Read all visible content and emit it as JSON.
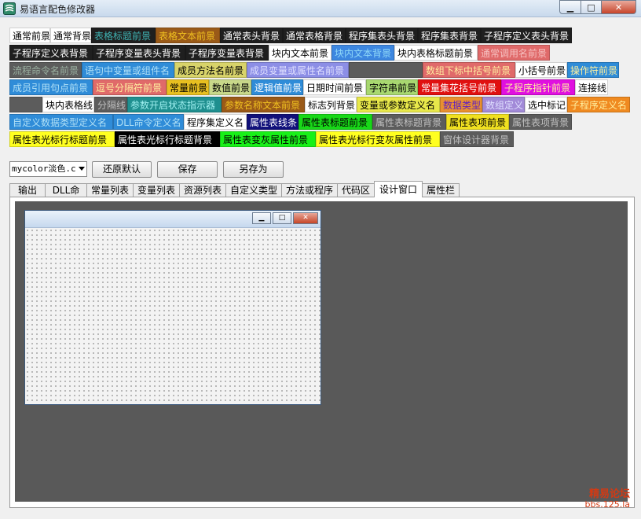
{
  "window": {
    "title": "易语言配色修改器",
    "min_glyph": "▁",
    "max_glyph": "□",
    "close_glyph": "✕"
  },
  "color_rows": [
    [
      {
        "label": "通常前景",
        "bg": "#ffffff",
        "fg": "#000000",
        "w": 52
      },
      {
        "label": "通常背景",
        "bg": "#ffffff",
        "fg": "#000000",
        "w": 52
      },
      {
        "label": "表格标题前景",
        "bg": "#1f1f1f",
        "fg": "#3fb3b3",
        "w": 82
      },
      {
        "label": "表格文本前景",
        "bg": "#9a5a18",
        "fg": "#f0c020",
        "w": 82
      },
      {
        "label": "通常表头背景",
        "bg": "#1f1f1f",
        "fg": "#ffffff",
        "w": 80
      },
      {
        "label": "通常表格背景",
        "bg": "#1f1f1f",
        "fg": "#ffffff",
        "w": 80
      },
      {
        "label": "程序集表头背景",
        "bg": "#1f1f1f",
        "fg": "#ffffff",
        "w": 92
      },
      {
        "label": "程序集表背景",
        "bg": "#1f1f1f",
        "fg": "#ffffff",
        "w": 80
      },
      {
        "label": "子程序定义表头背景",
        "bg": "#1f1f1f",
        "fg": "#ffffff",
        "w": 116
      }
    ],
    [
      {
        "label": "子程序定义表背景",
        "bg": "#1f1f1f",
        "fg": "#ffffff",
        "w": 106
      },
      {
        "label": "子程序变量表头背景",
        "bg": "#1f1f1f",
        "fg": "#ffffff",
        "w": 118
      },
      {
        "label": "子程序变量表背景",
        "bg": "#1f1f1f",
        "fg": "#ffffff",
        "w": 106
      },
      {
        "label": "块内文本前景",
        "bg": "#ffffff",
        "fg": "#000000",
        "w": 80
      },
      {
        "label": "块内文本背景",
        "bg": "#3d87e0",
        "fg": "#8fd8f8",
        "w": 80
      },
      {
        "label": "块内表格标题前景",
        "bg": "#ffffff",
        "fg": "#000000",
        "w": 106
      },
      {
        "label": "通常调用名前景",
        "bg": "#e06a6a",
        "fg": "#f6c0c0",
        "w": 92
      }
    ],
    [
      {
        "label": "流程命令名前景",
        "bg": "#5c5c5c",
        "fg": "#9ab0a0",
        "w": 92
      },
      {
        "label": "语句中变量或组件名",
        "bg": "#2f8cd8",
        "fg": "#b0e0f6",
        "w": 118
      },
      {
        "label": "成员方法名前景",
        "bg": "#d8d36a",
        "fg": "#000000",
        "w": 92
      },
      {
        "label": "成员变量或属性名前景",
        "bg": "#8c8ee6",
        "fg": "#e0e0ff",
        "w": 130
      },
      {
        "label": "",
        "bg": "#5c5c5c",
        "fg": "#ffffff",
        "w": 94
      },
      {
        "label": "数组下标中括号前景",
        "bg": "#e06a6a",
        "fg": "#fff0a0",
        "w": 118
      },
      {
        "label": "小括号前景",
        "bg": "#ffffff",
        "fg": "#000000",
        "w": 66
      },
      {
        "label": "操作符前景",
        "bg": "#2f8cd8",
        "fg": "#fff0a0",
        "w": 66
      }
    ],
    [
      {
        "label": "成员引用句点前景",
        "bg": "#2f8cd8",
        "fg": "#b0e0f6",
        "w": 106
      },
      {
        "label": "逗号分隔符前景",
        "bg": "#e06a6a",
        "fg": "#fff0a0",
        "w": 94
      },
      {
        "label": "常量前景",
        "bg": "#e8c020",
        "fg": "#000000",
        "w": 54
      },
      {
        "label": "数值前景",
        "bg": "#c8d88a",
        "fg": "#000000",
        "w": 54
      },
      {
        "label": "逻辑值前景",
        "bg": "#2f8cd8",
        "fg": "#ffffff",
        "w": 66
      },
      {
        "label": "日期时间前景",
        "bg": "#ffffff",
        "fg": "#000000",
        "w": 80
      },
      {
        "label": "字符串前景",
        "bg": "#a8d870",
        "fg": "#000000",
        "w": 66
      },
      {
        "label": "常量集花括号前景",
        "bg": "#e01010",
        "fg": "#ffffff",
        "w": 106
      },
      {
        "label": "子程序指针前景",
        "bg": "#e010e0",
        "fg": "#fff0a0",
        "w": 94
      },
      {
        "label": "连接线",
        "bg": "#ffffff",
        "fg": "#000000",
        "w": 42
      }
    ],
    [
      {
        "label": "",
        "bg": "#5c5c5c",
        "fg": "#ffffff",
        "w": 42
      },
      {
        "label": "块内表格线",
        "bg": "#ffffff",
        "fg": "#000000",
        "w": 66
      },
      {
        "label": "分隔线",
        "bg": "#5c5c5c",
        "fg": "#c0c0c0",
        "w": 42
      },
      {
        "label": "参数开启状态指示器",
        "bg": "#1f8f8f",
        "fg": "#a0f0f0",
        "w": 120
      },
      {
        "label": "参数名称文本前景",
        "bg": "#9a5a18",
        "fg": "#f0c020",
        "w": 106
      },
      {
        "label": "标志列背景",
        "bg": "#ffffff",
        "fg": "#000000",
        "w": 66
      },
      {
        "label": "变量或参数定义名",
        "bg": "#e8e84a",
        "fg": "#000000",
        "w": 106
      },
      {
        "label": "数据类型",
        "bg": "#e89030",
        "fg": "#6020c0",
        "w": 54
      },
      {
        "label": "数组定义",
        "bg": "#a28ad8",
        "fg": "#e0e0ff",
        "w": 54
      },
      {
        "label": "选中标记",
        "bg": "#ffffff",
        "fg": "#000000",
        "w": 54
      },
      {
        "label": "子程序定义名",
        "bg": "#f08a20",
        "fg": "#fff0a0",
        "w": 80
      }
    ],
    [
      {
        "label": "自定义数据类型定义名",
        "bg": "#2f8cd8",
        "fg": "#b0e0f6",
        "w": 132
      },
      {
        "label": "DLL命令定义名",
        "bg": "#2f8cd8",
        "fg": "#b0e0f6",
        "w": 90
      },
      {
        "label": "程序集定义名",
        "bg": "#ffffff",
        "fg": "#000000",
        "w": 80
      },
      {
        "label": "属性表线条",
        "bg": "#10107a",
        "fg": "#ffffff",
        "w": 66
      },
      {
        "label": "属性表标题前景",
        "bg": "#18d818",
        "fg": "#000000",
        "w": 94
      },
      {
        "label": "属性表标题背景",
        "bg": "#5c5c5c",
        "fg": "#c0c0c0",
        "w": 94
      },
      {
        "label": "属性表项前景",
        "bg": "#f0e020",
        "fg": "#000000",
        "w": 80
      },
      {
        "label": "属性表项背景",
        "bg": "#5c5c5c",
        "fg": "#c0c0c0",
        "w": 80
      }
    ],
    [
      {
        "label": "属性表光标行标题前景",
        "bg": "#ffff20",
        "fg": "#000000",
        "w": 134
      },
      {
        "label": "属性表光标行标题背景",
        "bg": "#000000",
        "fg": "#ffffff",
        "w": 134
      },
      {
        "label": "属性表变灰属性前景",
        "bg": "#18f018",
        "fg": "#000000",
        "w": 122
      },
      {
        "label": "属性表光标行变灰属性前景",
        "bg": "#ffff20",
        "fg": "#000000",
        "w": 158
      },
      {
        "label": "窗体设计器背景",
        "bg": "#5c5c5c",
        "fg": "#c0c0c0",
        "w": 94
      }
    ]
  ],
  "toolbar": {
    "scheme_value": "mycolor淡色.c",
    "restore_label": "还原默认",
    "save_label": "保存",
    "saveas_label": "另存为"
  },
  "tabs": [
    {
      "label": "输出",
      "active": false,
      "w": 46
    },
    {
      "label": "DLL命令",
      "active": false,
      "w": 54
    },
    {
      "label": "常量列表",
      "active": false,
      "w": 60
    },
    {
      "label": "变量列表",
      "active": false,
      "w": 60
    },
    {
      "label": "资源列表",
      "active": false,
      "w": 60
    },
    {
      "label": "自定义类型",
      "active": false,
      "w": 72
    },
    {
      "label": "方法或程序",
      "active": false,
      "w": 72
    },
    {
      "label": "代码区",
      "active": false,
      "w": 48
    },
    {
      "label": "设计窗口",
      "active": true,
      "w": 62
    },
    {
      "label": "属性栏",
      "active": false,
      "w": 48
    }
  ],
  "design_window": {
    "min_glyph": "▁",
    "max_glyph": "□",
    "close_glyph": "✕"
  },
  "watermark": {
    "line1": "精易论坛",
    "line2": "bbs.125.la"
  },
  "colors": {
    "canvas_bg": "#595959",
    "accent": "#3d87e0"
  }
}
